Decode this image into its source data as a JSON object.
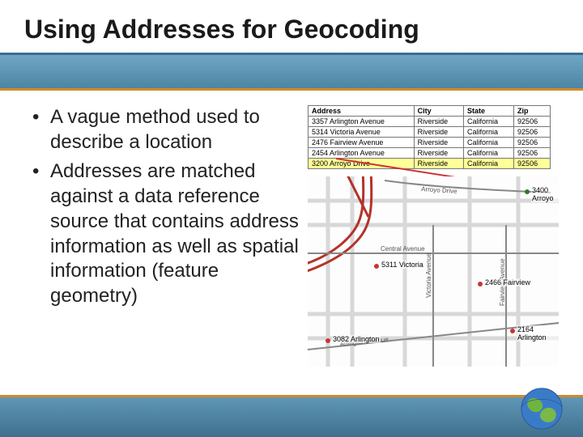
{
  "title": "Using Addresses for Geocoding",
  "bullets": [
    "A vague method used to describe a location",
    "Addresses are matched against a data reference source that contains address information as well as spatial information (feature geometry)"
  ],
  "table": {
    "headers": [
      "Address",
      "City",
      "State",
      "Zip"
    ],
    "rows": [
      [
        "3357 Arlington Avenue",
        "Riverside",
        "California",
        "92506"
      ],
      [
        "5314 Victoria Avenue",
        "Riverside",
        "California",
        "92506"
      ],
      [
        "2476 Fairview Avenue",
        "Riverside",
        "California",
        "92506"
      ],
      [
        "2454 Arlington Avenue",
        "Riverside",
        "California",
        "92506"
      ],
      [
        "3200 Arroyo Drive",
        "Riverside",
        "California",
        "92506"
      ]
    ]
  },
  "map": {
    "streets": [
      "Central Avenue",
      "Victoria Avenue",
      "Arlington Avenue",
      "Fairview Avenue",
      "Arroyo Drive"
    ],
    "markers": [
      {
        "label": "3400 Arroyo",
        "type": "grn"
      },
      {
        "label": "5311 Victoria",
        "type": "red"
      },
      {
        "label": "2466 Fairview",
        "type": "red"
      },
      {
        "label": "3082 Arlington",
        "type": "red"
      },
      {
        "label": "2164 Arlington",
        "type": "red"
      }
    ]
  }
}
